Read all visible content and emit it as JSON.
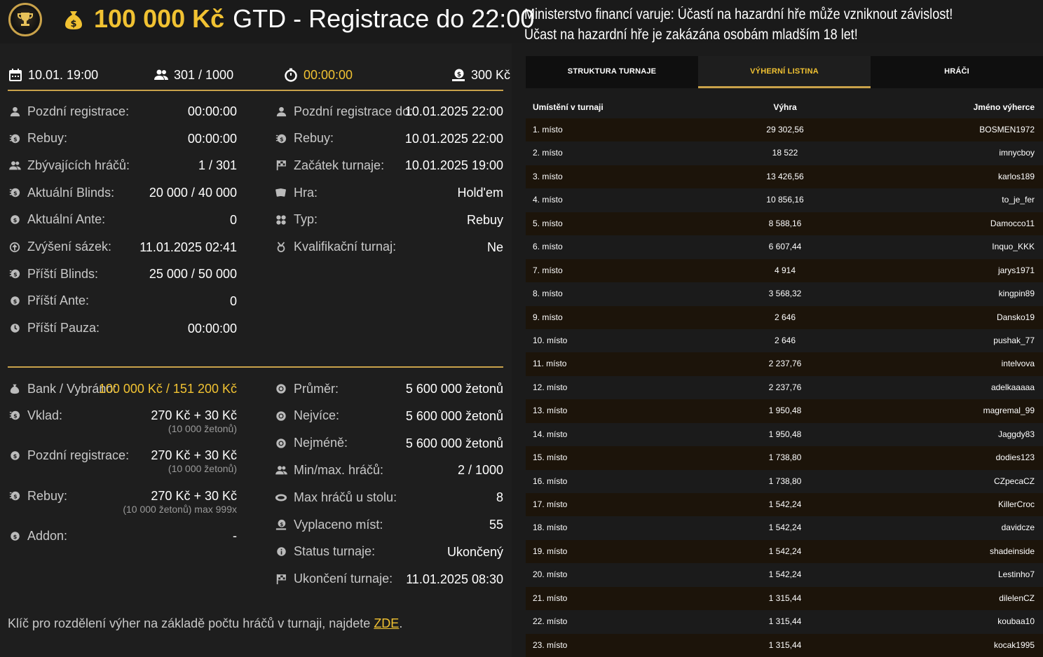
{
  "header": {
    "amount": "100 000 Kč",
    "title_rest": "GTD - Registrace do 22:00",
    "warning_line1": "Ministerstvo financí varuje: Účastí na hazardní hře může vzniknout závislost!",
    "warning_line2": "Účast na hazardní hře je zakázána osobám mladším 18 let!"
  },
  "summary": {
    "date": "10.01. 19:00",
    "players": "301 / 1000",
    "timer": "00:00:00",
    "buyin": "300 Kč"
  },
  "details_left": [
    {
      "icon": "user-icon",
      "label": "Pozdní registrace:",
      "value": "00:00:00"
    },
    {
      "icon": "rebuy-icon",
      "label": "Rebuy:",
      "value": "00:00:00"
    },
    {
      "icon": "users-icon",
      "label": "Zbývajících hráčů:",
      "value": "1 / 301"
    },
    {
      "icon": "blinds-icon",
      "label": "Aktuální Blinds:",
      "value": "20 000 / 40 000"
    },
    {
      "icon": "coin-icon",
      "label": "Aktuální Ante:",
      "value": "0"
    },
    {
      "icon": "level-up-icon",
      "label": "Zvýšení sázek:",
      "value": "11.01.2025 02:41"
    },
    {
      "icon": "blinds-icon",
      "label": "Příští Blinds:",
      "value": "25 000 / 50 000"
    },
    {
      "icon": "coin-icon",
      "label": "Příští Ante:",
      "value": "0"
    },
    {
      "icon": "clock-icon",
      "label": "Příští Pauza:",
      "value": "00:00:00"
    }
  ],
  "details_right": [
    {
      "icon": "user-icon",
      "label": "Pozdní registrace do:",
      "value": "10.01.2025 22:00"
    },
    {
      "icon": "rebuy-icon",
      "label": "Rebuy:",
      "value": "10.01.2025 22:00"
    },
    {
      "icon": "flag-icon",
      "label": "Začátek turnaje:",
      "value": "10.01.2025 19:00"
    },
    {
      "icon": "cards-icon",
      "label": "Hra:",
      "value": "Hold'em"
    },
    {
      "icon": "type-icon",
      "label": "Typ:",
      "value": "Rebuy"
    },
    {
      "icon": "qualifier-icon",
      "label": "Kvalifikační turnaj:",
      "value": "Ne"
    }
  ],
  "bank": {
    "label": "Bank / Vybráno:",
    "value": "100 000 Kč / 151 200 Kč"
  },
  "fees": [
    {
      "icon": "rebuy-icon",
      "label": "Vklad:",
      "value": "270 Kč + 30 Kč",
      "sub": "(10 000 žetonů)"
    },
    {
      "icon": "coin-icon",
      "label": "Pozdní registrace:",
      "value": "270 Kč + 30 Kč",
      "sub": "(10 000 žetonů)"
    },
    {
      "icon": "rebuy-icon",
      "label": "Rebuy:",
      "value": "270 Kč + 30 Kč",
      "sub": "(10 000 žetonů) max 999x"
    },
    {
      "icon": "coin-icon",
      "label": "Addon:",
      "value": "-",
      "sub": ""
    }
  ],
  "stats_right": [
    {
      "icon": "chip-icon",
      "label": "Průměr:",
      "value": "5 600 000 žetonů"
    },
    {
      "icon": "chip-icon",
      "label": "Nejvíce:",
      "value": "5 600 000 žetonů"
    },
    {
      "icon": "chip-icon",
      "label": "Nejméně:",
      "value": "5 600 000 žetonů"
    },
    {
      "icon": "users-icon",
      "label": "Min/max. hráčů:",
      "value": "2 / 1000"
    },
    {
      "icon": "table-icon",
      "label": "Max hráčů u stolu:",
      "value": "8"
    },
    {
      "icon": "payout-icon",
      "label": "Vyplaceno míst:",
      "value": "55"
    },
    {
      "icon": "info-icon",
      "label": "Status turnaje:",
      "value": "Ukončený"
    },
    {
      "icon": "flag-icon",
      "label": "Ukončení turnaje:",
      "value": "11.01.2025 08:30"
    }
  ],
  "footnote": {
    "text": "Klíč pro rozdělení výher na základě počtu hráčů v turnaji, najdete ",
    "link": "ZDE",
    "end": "."
  },
  "tabs": [
    "STRUKTURA TURNAJE",
    "VÝHERNÍ LISTINA",
    "HRÁČI"
  ],
  "active_tab": 1,
  "table": {
    "headers": [
      "Umístění v turnaji",
      "Výhra",
      "Jméno výherce"
    ],
    "rows": [
      [
        "1. místo",
        "29 302,56",
        "BOSMEN1972"
      ],
      [
        "2. místo",
        "18 522",
        "imnycboy"
      ],
      [
        "3. místo",
        "13 426,56",
        "karlos189"
      ],
      [
        "4. místo",
        "10 856,16",
        "to_je_fer"
      ],
      [
        "5. místo",
        "8 588,16",
        "Damocco11"
      ],
      [
        "6. místo",
        "6 607,44",
        "Inquo_KKK"
      ],
      [
        "7. místo",
        "4 914",
        "jarys1971"
      ],
      [
        "8. místo",
        "3 568,32",
        "kingpin89"
      ],
      [
        "9. místo",
        "2 646",
        "Dansko19"
      ],
      [
        "10. místo",
        "2 646",
        "pushak_77"
      ],
      [
        "11. místo",
        "2 237,76",
        "intelvova"
      ],
      [
        "12. místo",
        "2 237,76",
        "adelkaaaaa"
      ],
      [
        "13. místo",
        "1 950,48",
        "magremal_99"
      ],
      [
        "14. místo",
        "1 950,48",
        "Jaggdy83"
      ],
      [
        "15. místo",
        "1 738,80",
        "dodies123"
      ],
      [
        "16. místo",
        "1 738,80",
        "CZpecaCZ"
      ],
      [
        "17. místo",
        "1 542,24",
        "KillerCroc"
      ],
      [
        "18. místo",
        "1 542,24",
        "davidcze"
      ],
      [
        "19. místo",
        "1 542,24",
        "shadeinside"
      ],
      [
        "20. místo",
        "1 542,24",
        "Lestinho7"
      ],
      [
        "21. místo",
        "1 315,44",
        "dilelenCZ"
      ],
      [
        "22. místo",
        "1 315,44",
        "koubaa10"
      ],
      [
        "23. místo",
        "1 315,44",
        "kocak1995"
      ]
    ]
  },
  "colors": {
    "accent": "#f1c232",
    "gold_line": "#c9a24a",
    "background": "#1b1b1b",
    "row_odd": "#1c140a"
  }
}
